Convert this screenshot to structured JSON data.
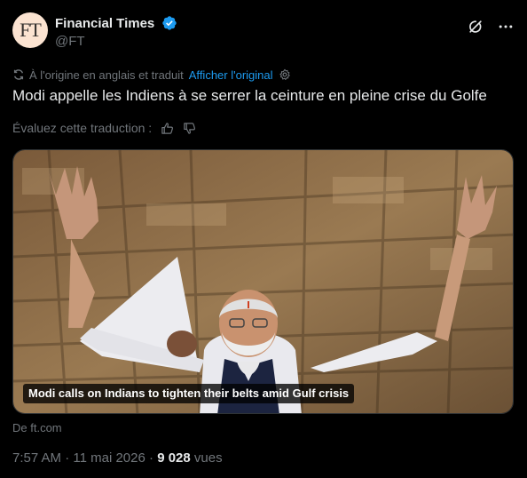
{
  "author": {
    "initials": "FT",
    "display_name": "Financial Times",
    "handle": "@FT"
  },
  "translation": {
    "notice": "À l'origine en anglais et traduit",
    "show_original_label": "Afficher l'original",
    "rate_label": "Évaluez cette traduction :"
  },
  "tweet": {
    "text": "Modi appelle les Indiens à se serrer la ceinture en pleine crise du Golfe"
  },
  "card": {
    "caption": "Modi calls on Indians to tighten their belts amid Gulf crisis",
    "source": "De ft.com"
  },
  "meta": {
    "time": "7:57 AM",
    "separator": "·",
    "date": "11 mai 2026",
    "views_count": "9 028",
    "views_label": "vues"
  },
  "colors": {
    "background": "#000000",
    "text": "#e7e9ea",
    "secondary": "#71767b",
    "accent": "#1d9bf0",
    "avatar_bg": "#fbe3d1"
  },
  "icons": [
    "verified-badge-icon",
    "grok-icon",
    "more-icon",
    "translate-icon",
    "gear-icon",
    "thumbs-up-icon",
    "thumbs-down-icon"
  ]
}
